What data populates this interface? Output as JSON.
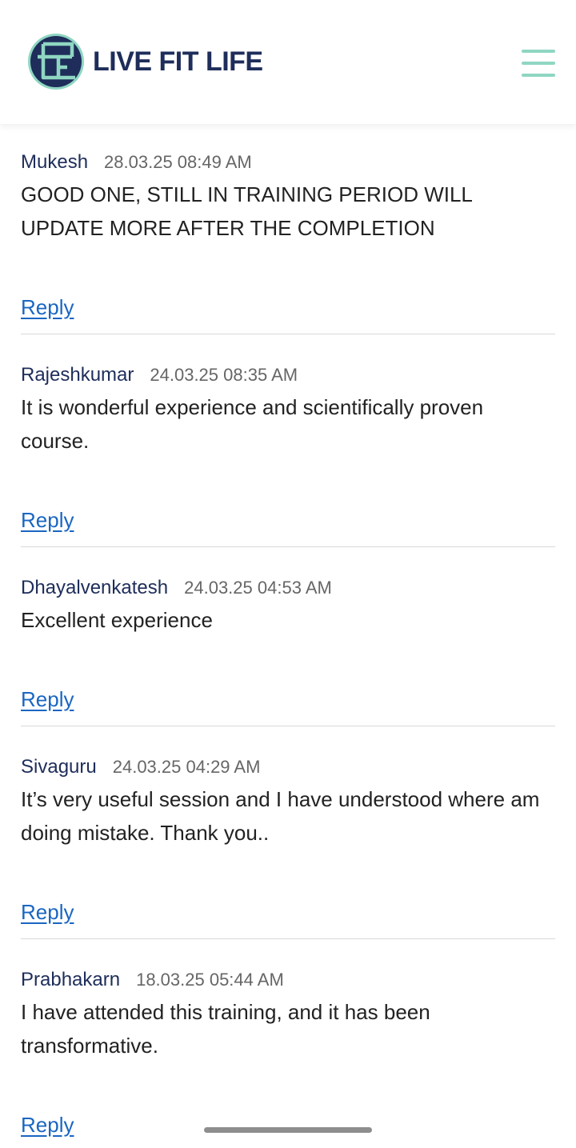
{
  "brand": {
    "name": "LIVE FIT LIFE",
    "logo_icon": "lfl-monogram-icon",
    "color_navy": "#1e2d5a",
    "color_teal": "#8fd6c2"
  },
  "header": {
    "menu_icon": "hamburger-menu-icon"
  },
  "colors": {
    "link": "#1a66c2",
    "author": "#1e2d5a",
    "date": "#666666"
  },
  "comments": [
    {
      "author": "Mukesh",
      "date": "28.03.25 08:49 AM",
      "text": "GOOD ONE, STILL IN TRAINING PERIOD WILL UPDATE MORE AFTER THE COMPLETION",
      "reply_label": "Reply"
    },
    {
      "author": "Rajeshkumar",
      "date": "24.03.25 08:35 AM",
      "text": "It is wonderful experience and scientifically proven course.",
      "reply_label": "Reply"
    },
    {
      "author": "Dhayalvenkatesh",
      "date": "24.03.25 04:53 AM",
      "text": "Excellent experience",
      "reply_label": "Reply"
    },
    {
      "author": "Sivaguru",
      "date": "24.03.25 04:29 AM",
      "text": "It’s very useful session and I have understood where am doing mistake. Thank you..",
      "reply_label": "Reply"
    },
    {
      "author": "Prabhakarn",
      "date": "18.03.25 05:44 AM",
      "text": "I have attended this training, and it has been transformative.",
      "reply_label": "Reply"
    }
  ]
}
